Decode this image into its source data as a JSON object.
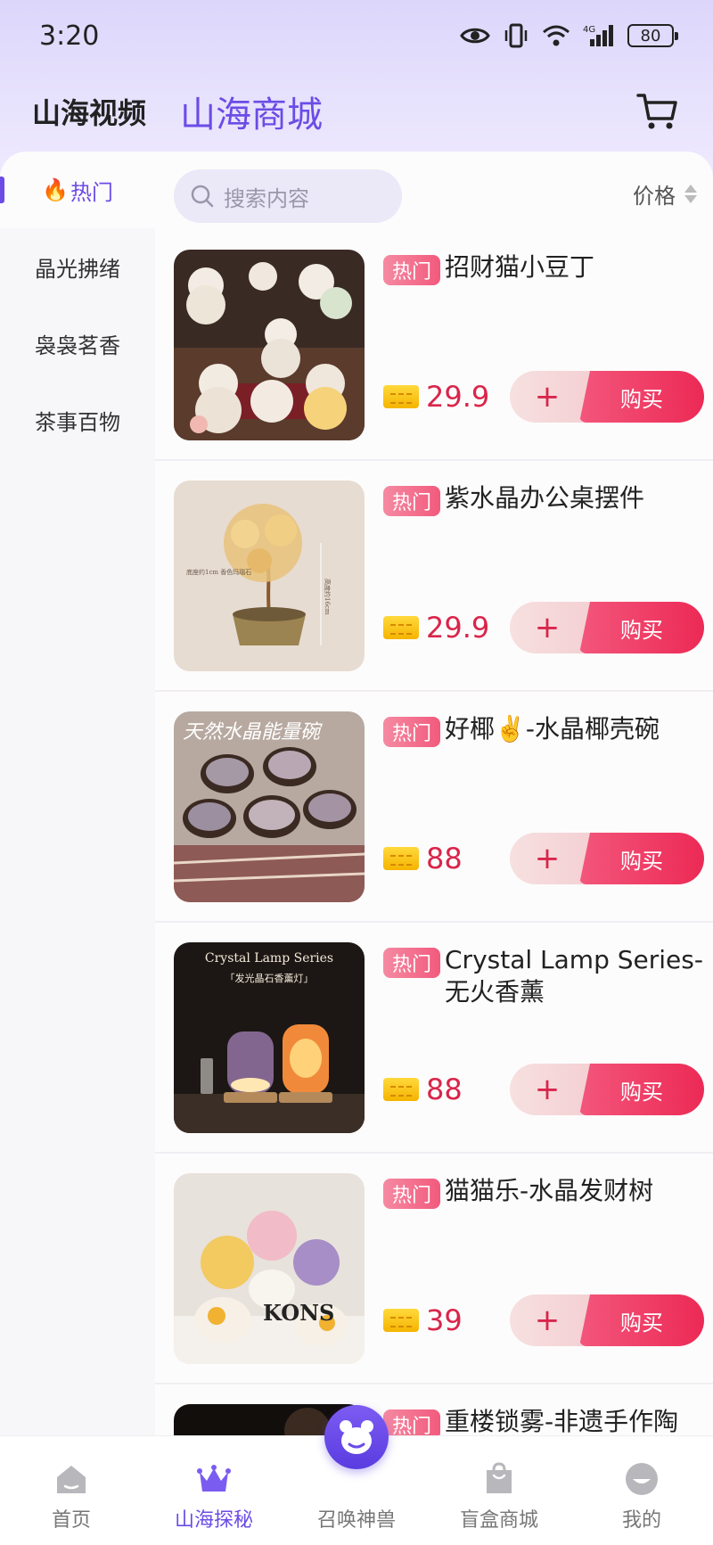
{
  "status": {
    "time": "3:20",
    "battery": "80"
  },
  "header": {
    "tab_video": "山海视频",
    "tab_mall": "山海商城"
  },
  "sidebar": {
    "items": [
      {
        "label": "热门",
        "active": true
      },
      {
        "label": "晶光拂绪"
      },
      {
        "label": "袅袅茗香"
      },
      {
        "label": "茶事百物"
      }
    ]
  },
  "search": {
    "placeholder": "搜索内容"
  },
  "sort": {
    "label": "价格"
  },
  "badge_hot": "热门",
  "buttons": {
    "add": "+",
    "buy": "购买"
  },
  "products": [
    {
      "name": "招财猫小豆丁",
      "price": "29.9"
    },
    {
      "name": "紫水晶办公桌摆件",
      "price": "29.9"
    },
    {
      "name": "好椰✌️-水晶椰壳碗",
      "price": "88"
    },
    {
      "name": "Crystal Lamp Series-无火香薰",
      "price": "88"
    },
    {
      "name": "猫猫乐-水晶发财树",
      "price": "39"
    },
    {
      "name": "重楼锁雾-非遗手作陶",
      "price": ""
    }
  ],
  "image_text": {
    "tree_note_left": "底座约1cm 香色玛瑙石",
    "tree_note_right": "高度约16cm",
    "bowl_title": "天然水晶能量碗",
    "lamp_title": "Crystal Lamp Series",
    "lamp_sub": "「发光晶石香薰灯」",
    "tree2_text": "KONS"
  },
  "bottom_nav": [
    {
      "label": "首页",
      "icon": "home-icon"
    },
    {
      "label": "山海探秘",
      "icon": "crown-icon",
      "active": true
    },
    {
      "label": "召唤神兽",
      "icon": "beast-icon"
    },
    {
      "label": "盲盒商城",
      "icon": "bag-icon"
    },
    {
      "label": "我的",
      "icon": "profile-icon"
    }
  ],
  "colors": {
    "accent": "#6b4ce6",
    "price": "#d9254b",
    "buy": "#ec2a55"
  }
}
